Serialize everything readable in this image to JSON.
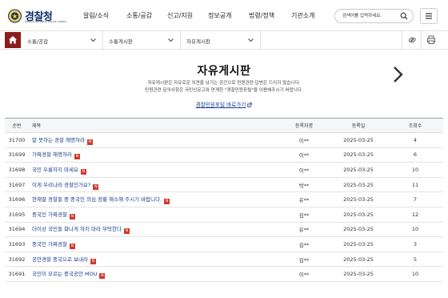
{
  "header": {
    "logo_name": "경찰청",
    "logo_sub": "KOREAN NATIONAL POLICE AGENCY",
    "nav": [
      "알림/소식",
      "소통/공감",
      "신고/지원",
      "정보공개",
      "법령/정책",
      "기관소개"
    ],
    "search_placeholder": "검색어를 입력하세요."
  },
  "location": {
    "crumbs": [
      "소통/공감",
      "소통게시판",
      "자유게시판"
    ]
  },
  "page": {
    "title": "자유게시판",
    "intro_line1": "자유게시판은 자유로운 의견을 남기는 공간으로 민원관련 답변은 드리지 않습니다.",
    "intro_line2": "민원관련 문의사항은 국민신문고와 연계한 \"경찰민원포털\"을 이용해주시기 바랍니다.",
    "portal_link": "경찰민원포털 바로가기"
  },
  "table": {
    "columns": {
      "no": "순번",
      "title": "제목",
      "author": "등록자명",
      "date": "등록일",
      "views": "조회수"
    },
    "new_badge": "N",
    "rows": [
      {
        "no": "31700",
        "title": "말 못하는 경찰 해명하라",
        "author": "이**",
        "date": "2025-03-25",
        "views": "4"
      },
      {
        "no": "31699",
        "title": "가짜경찰 해명하라",
        "author": "이**",
        "date": "2025-03-25",
        "views": "6"
      },
      {
        "no": "31698",
        "title": "국민 우롱하지 마세요",
        "author": "이**",
        "date": "2025-03-25",
        "views": "10"
      },
      {
        "no": "31697",
        "title": "이게 우리나라 경찰인가요?",
        "author": "박**",
        "date": "2025-03-25",
        "views": "11"
      },
      {
        "no": "31696",
        "title": "현재딸 경찰들 중 중국인 의심 정황 해소해 주시기 바랍니다.",
        "author": "유**",
        "date": "2025-03-25",
        "views": "7"
      },
      {
        "no": "31695",
        "title": "중국인 가짜경찰",
        "author": "김**",
        "date": "2025-03-25",
        "views": "12"
      },
      {
        "no": "31694",
        "title": "더이상 국민들 화나게 하지 마라 부탁한다",
        "author": "유**",
        "date": "2025-03-25",
        "views": "10"
      },
      {
        "no": "31693",
        "title": "중국인 가짜경찰",
        "author": "김**",
        "date": "2025-03-25",
        "views": "3"
      },
      {
        "no": "31692",
        "title": "공안경찰 중국으로 보내라",
        "author": "김**",
        "date": "2025-03-25",
        "views": "5"
      },
      {
        "no": "31691",
        "title": "국민이 모르는 중국공안 MOU",
        "author": "이**",
        "date": "2025-03-25",
        "views": "10"
      }
    ]
  },
  "colors": {
    "brand_navy": "#0d2f6e",
    "home_red": "#8c1c1c",
    "new_badge_red": "#cf3a2f",
    "link_blue": "#1a3d8f"
  }
}
